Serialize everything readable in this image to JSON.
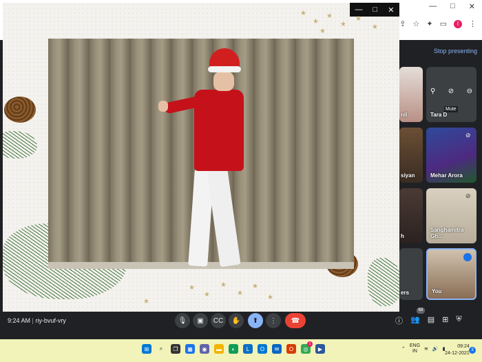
{
  "browser": {
    "controls": [
      "—",
      "□",
      "✕"
    ],
    "profile_initial": "I"
  },
  "meet": {
    "stop_presenting_label": "Stop presenting",
    "time": "9:24 AM",
    "meeting_code": "riy-bvuf-vry",
    "participant_count": "68",
    "mute_tooltip": "Mute",
    "participants": [
      {
        "name": "Tara D"
      },
      {
        "name": "Mehar Arora"
      },
      {
        "name": "Sanghamitra Gh..."
      },
      {
        "name": "You"
      }
    ],
    "partial_labels": [
      "nil",
      "siyan",
      "h",
      "ers"
    ]
  },
  "slide_window": {
    "controls": [
      "—",
      "□",
      "✕"
    ]
  },
  "taskbar": {
    "lang_top": "ENG",
    "lang_bottom": "IN",
    "clock_time": "09:24",
    "clock_date": "24-12-2021",
    "notification_count": "3",
    "chrome_badge": "1"
  },
  "colors": {
    "meet_bg": "#202124",
    "accent_blue": "#8ab4f8",
    "end_call": "#ea4335",
    "taskbar_bg": "#f2f3b8",
    "sweater_red": "#c5121a"
  }
}
